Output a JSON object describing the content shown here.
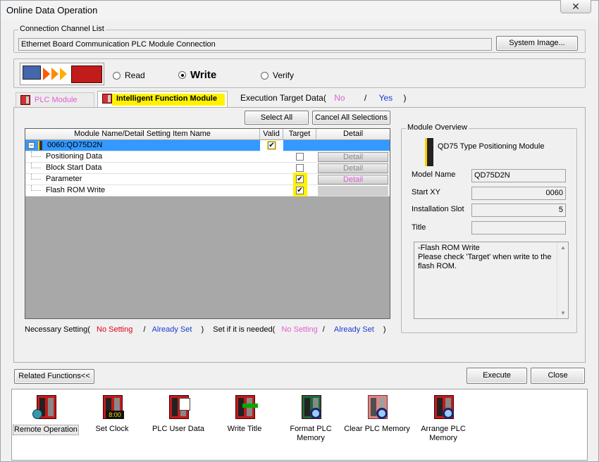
{
  "window": {
    "title": "Online Data Operation",
    "close_label": "✕"
  },
  "connection": {
    "group_label": "Connection Channel List",
    "value": "Ethernet Board Communication PLC Module Connection",
    "system_image_label": "System Image..."
  },
  "mode": {
    "read_label": "Read",
    "write_label": "Write",
    "verify_label": "Verify",
    "selected": "Write"
  },
  "tabs": [
    {
      "label": "PLC Module"
    },
    {
      "label": "Intelligent Function Module"
    }
  ],
  "execution_target": {
    "label": "Execution Target Data(",
    "no": "No",
    "sep": "/",
    "yes": "Yes",
    "close": ")"
  },
  "buttons": {
    "select_all": "Select All",
    "cancel_all": "Cancel All Selections",
    "related": "Related Functions<<",
    "execute": "Execute",
    "close": "Close"
  },
  "grid": {
    "headers": [
      "Module Name/Detail Setting Item Name",
      "Valid",
      "Target",
      "Detail"
    ],
    "module": "0060:QD75D2N",
    "items": [
      {
        "name": "Positioning Data",
        "target": false,
        "detail": "Detail"
      },
      {
        "name": "Block Start Data",
        "target": false,
        "detail": "Detail"
      },
      {
        "name": "Parameter",
        "target": true,
        "detail": "Detail"
      },
      {
        "name": "Flash ROM Write",
        "target": true,
        "detail": ""
      }
    ]
  },
  "legend": {
    "necessary": "Necessary Setting(",
    "no_setting": "No Setting",
    "slash": "/",
    "already_set": "Already Set",
    "close": ")",
    "set_if_needed": "Set if it is needed(",
    "no_setting2": "No Setting",
    "already_set2": "Already Set"
  },
  "overview": {
    "group_label": "Module Overview",
    "module_desc": "QD75 Type Positioning Module",
    "model_name_label": "Model Name",
    "model_name": "QD75D2N",
    "start_xy_label": "Start XY",
    "start_xy": "0060",
    "slot_label": "Installation Slot",
    "slot": "5",
    "title_label": "Title",
    "title": "",
    "note_line1": "-Flash ROM Write",
    "note_line2": "Please check 'Target' when write to the",
    "note_line3": "flash ROM."
  },
  "tools": [
    {
      "label1": "Remote Operation",
      "label2": "",
      "icon": "remote-operation-icon"
    },
    {
      "label1": "Set Clock",
      "label2": "",
      "icon": "set-clock-icon"
    },
    {
      "label1": "PLC User Data",
      "label2": "",
      "icon": "plc-user-data-icon"
    },
    {
      "label1": "Write Title",
      "label2": "",
      "icon": "write-title-icon"
    },
    {
      "label1": "Format PLC",
      "label2": "Memory",
      "icon": "format-plc-memory-icon"
    },
    {
      "label1": "Clear PLC Memory",
      "label2": "",
      "icon": "clear-plc-memory-icon"
    },
    {
      "label1": "Arrange PLC",
      "label2": "Memory",
      "icon": "arrange-plc-memory-icon"
    }
  ],
  "clock_text": "8:00",
  "colors": {
    "highlight": "#fff200",
    "no_setting": "#e0001b",
    "already_set": "#1a3ccf",
    "optional": "#e060d0",
    "selection": "#3399ff"
  }
}
